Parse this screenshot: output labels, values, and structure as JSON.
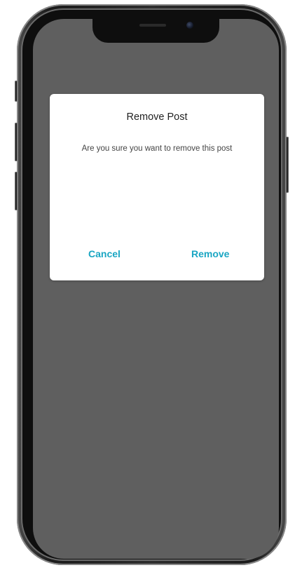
{
  "dialog": {
    "title": "Remove Post",
    "message": "Are you sure you want to remove this post",
    "cancel_label": "Cancel",
    "remove_label": "Remove"
  },
  "colors": {
    "accent": "#1aa6c3",
    "overlay": "#5f5f5f",
    "dialog_bg": "#ffffff"
  }
}
